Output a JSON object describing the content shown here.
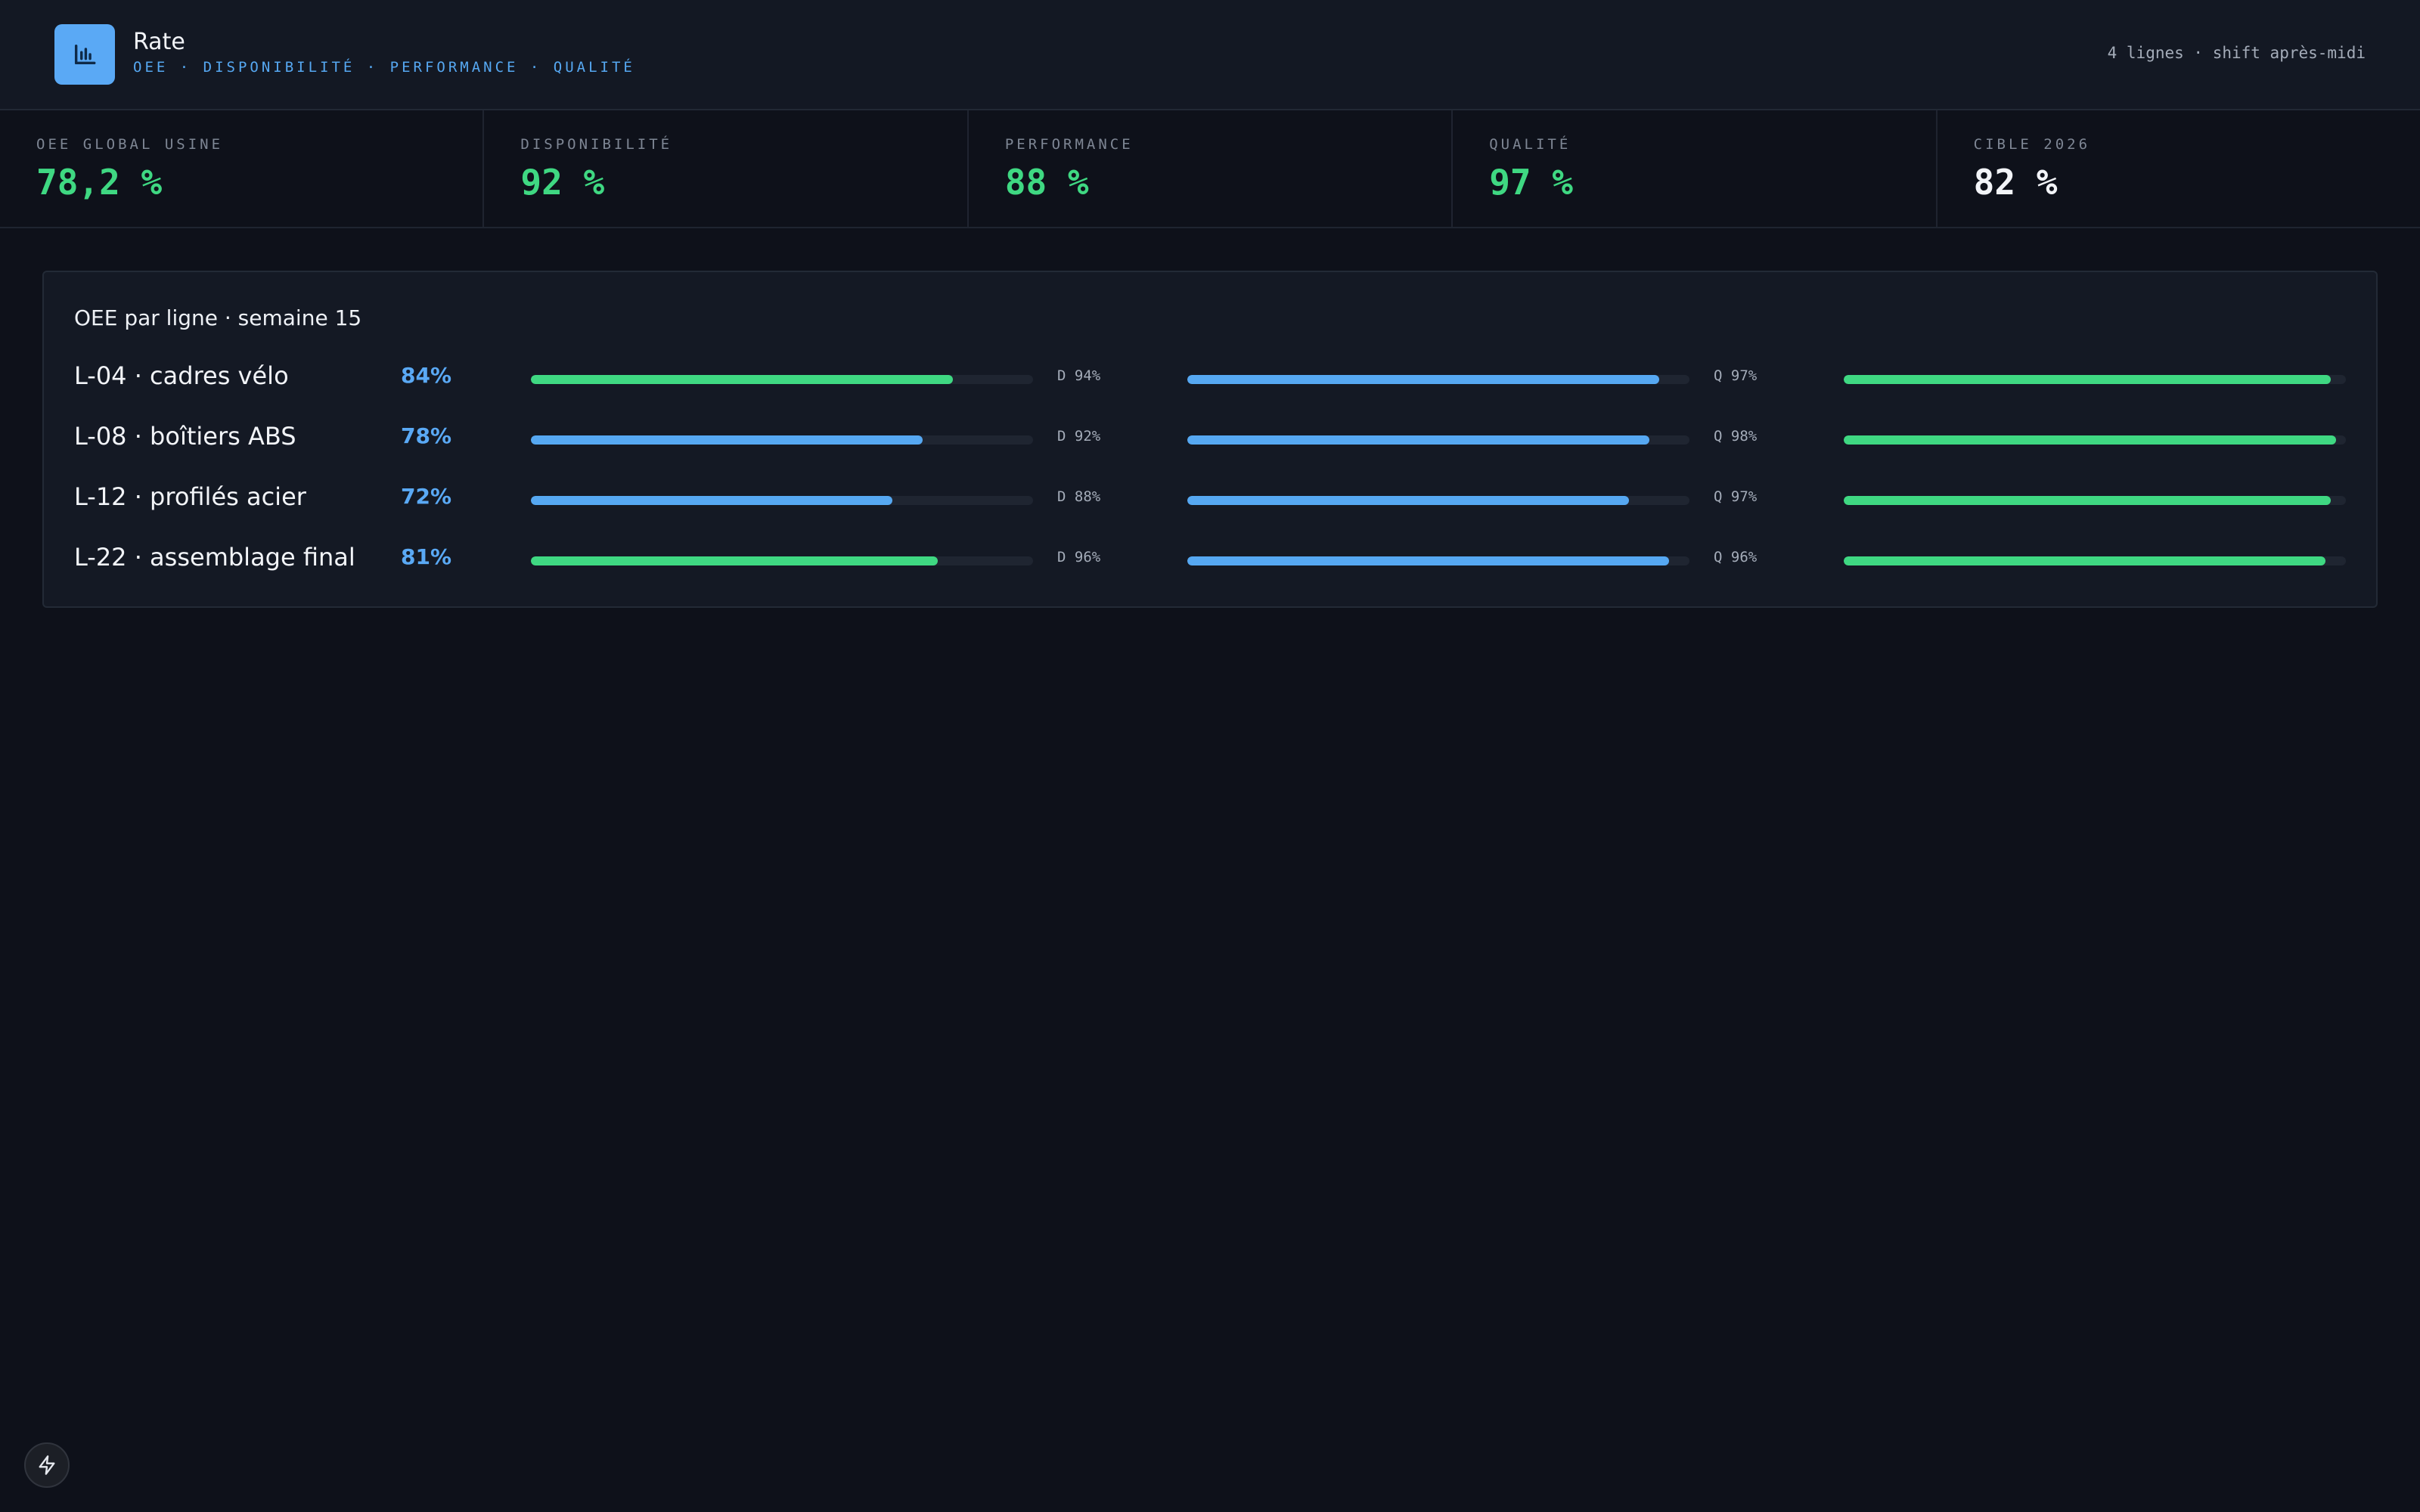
{
  "header": {
    "title": "Rate",
    "subtitle": "OEE · DISPONIBILITÉ · PERFORMANCE · QUALITÉ",
    "meta": "4 lignes · shift après-midi",
    "logo_icon": "bar-chart-icon"
  },
  "kpis": [
    {
      "label": "OEE GLOBAL USINE",
      "value": "78,2 %",
      "color": "#3fd882"
    },
    {
      "label": "DISPONIBILITÉ",
      "value": "92 %",
      "color": "#3fd882"
    },
    {
      "label": "PERFORMANCE",
      "value": "88 %",
      "color": "#3fd882"
    },
    {
      "label": "QUALITÉ",
      "value": "97 %",
      "color": "#3fd882"
    },
    {
      "label": "CIBLE 2026",
      "value": "82 %",
      "color": "#f2f4f8"
    }
  ],
  "panel": {
    "title": "OEE par ligne · semaine 15",
    "lines": [
      {
        "name": "L-04 · cadres vélo",
        "oee": "84%",
        "oee_value": 84,
        "oee_color": "green",
        "d_label": "D 94%",
        "d_value": 94,
        "q_label": "Q 97%",
        "q_value": 97
      },
      {
        "name": "L-08 · boîtiers ABS",
        "oee": "78%",
        "oee_value": 78,
        "oee_color": "blue",
        "d_label": "D 92%",
        "d_value": 92,
        "q_label": "Q 98%",
        "q_value": 98
      },
      {
        "name": "L-12 · profilés acier",
        "oee": "72%",
        "oee_value": 72,
        "oee_color": "blue",
        "d_label": "D 88%",
        "d_value": 88,
        "q_label": "Q 97%",
        "q_value": 97
      },
      {
        "name": "L-22 · assemblage final",
        "oee": "81%",
        "oee_value": 81,
        "oee_color": "green",
        "d_label": "D 96%",
        "d_value": 96,
        "q_label": "Q 96%",
        "q_value": 96
      }
    ]
  },
  "colors": {
    "green": "#3fd882",
    "blue": "#56a8f2",
    "background": "#0e111a"
  },
  "fab_icon": "lightning-icon"
}
